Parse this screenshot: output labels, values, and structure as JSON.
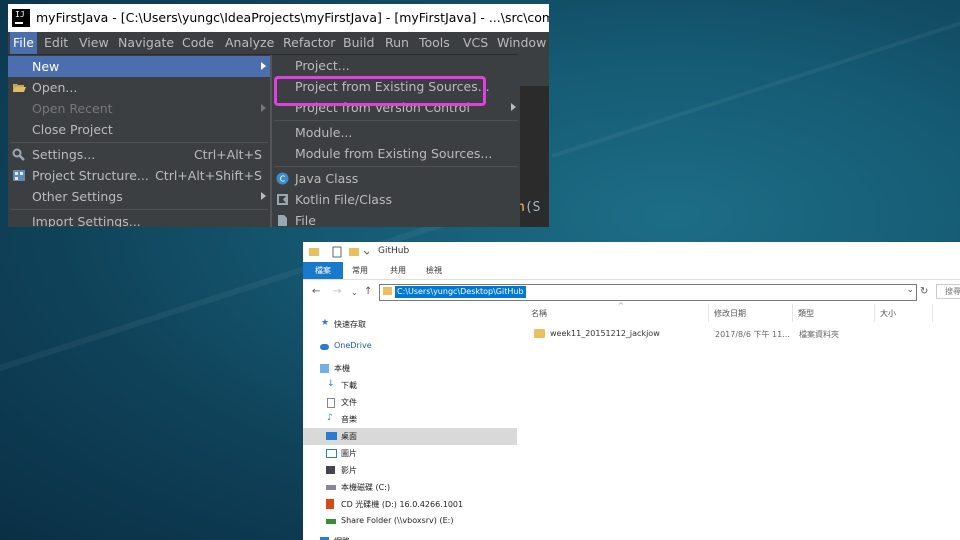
{
  "ide": {
    "title": "myFirstJava - [C:\\Users\\yungc\\IdeaProjects\\myFirstJava] - [myFirstJava] - ...\\src\\com\\compan",
    "menubar": [
      "File",
      "Edit",
      "View",
      "Navigate",
      "Code",
      "Analyze",
      "Refactor",
      "Build",
      "Run",
      "Tools",
      "VCS",
      "Window"
    ],
    "file_menu": [
      {
        "label": "New",
        "shortcut": "",
        "submenu": true,
        "selected": true
      },
      {
        "label": "Open...",
        "shortcut": "",
        "icon": "folder-open-icon"
      },
      {
        "label": "Open Recent",
        "shortcut": "",
        "submenu": true,
        "disabled": true
      },
      {
        "label": "Close Project",
        "shortcut": ""
      },
      {
        "label": "Settings...",
        "shortcut": "Ctrl+Alt+S",
        "icon": "wrench-icon"
      },
      {
        "label": "Project Structure...",
        "shortcut": "Ctrl+Alt+Shift+S",
        "icon": "project-structure-icon"
      },
      {
        "label": "Other Settings",
        "shortcut": "",
        "submenu": true
      },
      {
        "label": "Import Settings...",
        "shortcut": ""
      }
    ],
    "new_submenu": [
      {
        "label": "Project..."
      },
      {
        "label": "Project from Existing Sources...",
        "highlighted": true
      },
      {
        "label": "Project from Version Control",
        "submenu": true
      },
      {
        "label": "Module..."
      },
      {
        "label": "Module from Existing Sources..."
      },
      {
        "label": "Java Class",
        "icon": "java-class-icon"
      },
      {
        "label": "Kotlin File/Class",
        "icon": "kotlin-icon"
      },
      {
        "label": "File",
        "icon": "file-icon"
      }
    ],
    "code_fragment": {
      "fn": "n",
      "rest": "(S"
    },
    "colors": {
      "menu_bg": "#3c3f41",
      "selection": "#4b6eaf",
      "highlight_box": "#e040e0"
    }
  },
  "explorer": {
    "title": "GitHub",
    "ribbon_tabs": [
      "檔案",
      "常用",
      "共用",
      "檢視"
    ],
    "address_path": "C:\\Users\\yungc\\Desktop\\GitHub",
    "search_placeholder": "搜尋",
    "nav_items": [
      {
        "label": "快速存取",
        "icon": "star-icon"
      },
      {
        "label": "OneDrive",
        "icon": "cloud-icon"
      },
      {
        "label": "本機",
        "icon": "computer-icon"
      },
      {
        "label": "下載",
        "icon": "download-icon"
      },
      {
        "label": "文件",
        "icon": "document-icon"
      },
      {
        "label": "音樂",
        "icon": "music-icon"
      },
      {
        "label": "桌面",
        "icon": "desktop-icon",
        "selected": true
      },
      {
        "label": "圖片",
        "icon": "picture-icon"
      },
      {
        "label": "影片",
        "icon": "video-icon"
      },
      {
        "label": "本機磁碟 (C:)",
        "icon": "drive-icon"
      },
      {
        "label": "CD 光碟機 (D:) 16.0.4266.1001",
        "icon": "office-icon"
      },
      {
        "label": "Share Folder (\\\\vboxsrv) (E:)",
        "icon": "network-drive-icon"
      },
      {
        "label": "網路",
        "icon": "network-icon"
      }
    ],
    "columns": [
      "名稱",
      "修改日期",
      "類型",
      "大小"
    ],
    "files": [
      {
        "name": "week11_20151212_jackjow",
        "modified": "2017/8/6 下午 11...",
        "type": "檔案資料夾",
        "size": ""
      }
    ]
  }
}
